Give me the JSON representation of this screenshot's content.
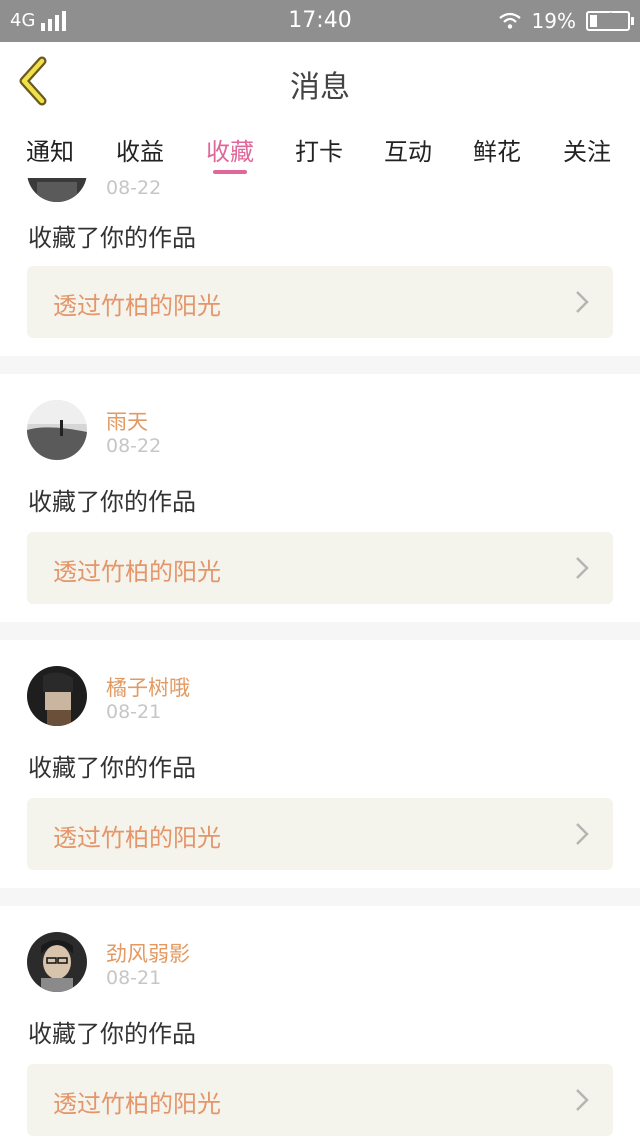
{
  "status_bar": {
    "network": "4G",
    "time": "17:40",
    "battery_pct": "19%"
  },
  "header": {
    "title": "消息"
  },
  "tabs": [
    {
      "label": "通知"
    },
    {
      "label": "收益"
    },
    {
      "label": "收藏"
    },
    {
      "label": "打卡"
    },
    {
      "label": "互动"
    },
    {
      "label": "鲜花"
    },
    {
      "label": "关注"
    }
  ],
  "active_tab": "收藏",
  "messages": [
    {
      "user": "",
      "date": "08-22",
      "action": "收藏了你的作品",
      "work_title": "透过竹柏的阳光"
    },
    {
      "user": "雨天",
      "date": "08-22",
      "action": "收藏了你的作品",
      "work_title": "透过竹柏的阳光"
    },
    {
      "user": "橘子树哦",
      "date": "08-21",
      "action": "收藏了你的作品",
      "work_title": "透过竹柏的阳光"
    },
    {
      "user": "劲风弱影",
      "date": "08-21",
      "action": "收藏了你的作品",
      "work_title": "透过竹柏的阳光"
    }
  ],
  "colors": {
    "accent": "#e0679a",
    "username": "#e29a62",
    "work_bg": "#f4f4ec",
    "status_bar": "#8f8f8f"
  }
}
